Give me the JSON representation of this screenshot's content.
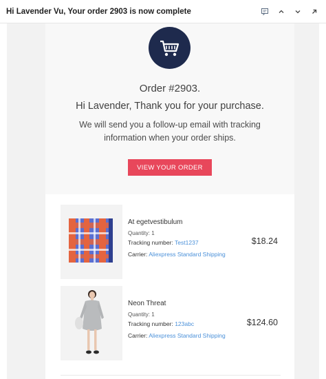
{
  "header": {
    "subject": "Hi Lavender Vu, Your order 2903 is now complete",
    "actions": [
      {
        "icon": "message-icon"
      },
      {
        "icon": "chevron-up-icon"
      },
      {
        "icon": "chevron-down-icon"
      },
      {
        "icon": "arrow-up-right-icon"
      }
    ]
  },
  "email": {
    "icon": "shopping-cart-icon",
    "order_number": "Order #2903.",
    "greeting": "Hi Lavender, Thank you for your purchase.",
    "followup": "We will send you a follow-up email with tracking information when your order ships.",
    "view_button": "VIEW YOUR ORDER",
    "colors": {
      "accent": "#e8475b",
      "circle": "#1e2a4d",
      "link": "#4a90d9"
    }
  },
  "items": [
    {
      "name": "At egetvestibulum",
      "quantity": "Quantity: 1",
      "tracking_label": "Tracking number:",
      "tracking_value": "Test1237",
      "carrier_label": "Carrier:",
      "carrier_value": "Aliexpress Standard Shipping",
      "price": "$18.24",
      "image": "plaid-scarf"
    },
    {
      "name": "Neon Threat",
      "quantity": "Quantity: 1",
      "tracking_label": "Tracking number:",
      "tracking_value": "123abc",
      "carrier_label": "Carrier:",
      "carrier_value": "Aliexpress Standard Shipping",
      "price": "$124.60",
      "image": "grey-dress-model"
    }
  ]
}
